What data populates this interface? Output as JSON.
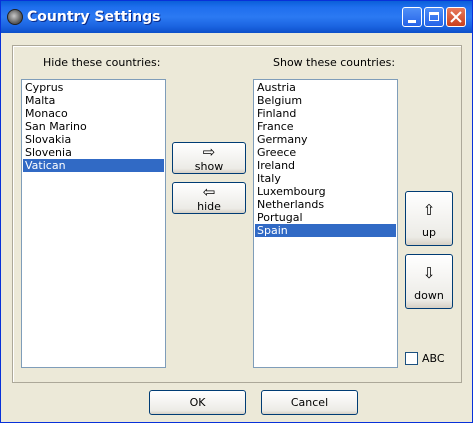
{
  "window": {
    "title": "Country Settings"
  },
  "hidden": {
    "label": "Hide these countries:",
    "items": [
      "Cyprus",
      "Malta",
      "Monaco",
      "San Marino",
      "Slovakia",
      "Slovenia",
      "Vatican"
    ],
    "selected": "Vatican"
  },
  "shown": {
    "label": "Show these countries:",
    "items": [
      "Austria",
      "Belgium",
      "Finland",
      "France",
      "Germany",
      "Greece",
      "Ireland",
      "Italy",
      "Luxembourg",
      "Netherlands",
      "Portugal",
      "Spain"
    ],
    "selected": "Spain"
  },
  "buttons": {
    "show": {
      "glyph": "⇨",
      "label": "show"
    },
    "hide": {
      "glyph": "⇦",
      "label": "hide"
    },
    "up": {
      "glyph": "⇧",
      "label": "up"
    },
    "down": {
      "glyph": "⇩",
      "label": "down"
    },
    "ok": "OK",
    "cancel": "Cancel"
  },
  "abc": {
    "label": "ABC",
    "checked": false
  },
  "icons": {
    "app": "globe-icon",
    "minimize": "minimize-icon",
    "maximize": "maximize-icon",
    "close": "close-icon"
  }
}
